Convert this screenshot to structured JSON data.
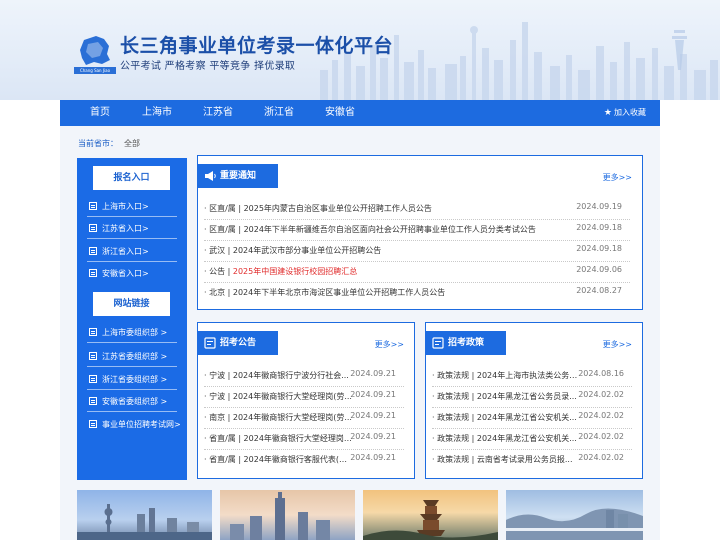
{
  "header": {
    "title": "长三角事业单位考录一体化平台",
    "slogan": "公平考试 严格考察 平等竞争 择优录取",
    "logo_caption": "Chang San Jiao"
  },
  "nav": {
    "items": [
      "首页",
      "上海市",
      "江苏省",
      "浙江省",
      "安徽省"
    ],
    "favorite": "加入收藏"
  },
  "crumb": {
    "label": "当前省市：",
    "value": "全部"
  },
  "sidebar": {
    "signup_title": "报名入口",
    "signup_links": [
      "上海市入口>",
      "江苏省入口>",
      "浙江省入口>",
      "安徽省入口>"
    ],
    "sites_title": "网站链接",
    "site_links": [
      "上海市委组织部 >",
      "江苏省委组织部 >",
      "浙江省委组织部 >",
      "安徽省委组织部 >",
      "事业单位招聘考试网>"
    ]
  },
  "notice": {
    "title": "重要通知",
    "more": "更多>>",
    "rows": [
      {
        "prefix": "· 区直/属 | ",
        "text": "2025年内蒙古自治区事业单位公开招聘工作人员公告",
        "date": "2024.09.19",
        "highlight": false
      },
      {
        "prefix": "· 区直/属 | ",
        "text": "2024年下半年新疆维吾尔自治区面向社会公开招聘事业单位工作人员分类考试公告",
        "date": "2024.09.18",
        "highlight": false
      },
      {
        "prefix": "· 武汉 | ",
        "text": "2024年武汉市部分事业单位公开招聘公告",
        "date": "2024.09.18",
        "highlight": false
      },
      {
        "prefix": "· 公告 | ",
        "text": "2025年中国建设银行校园招聘汇总",
        "date": "2024.09.06",
        "highlight": true
      },
      {
        "prefix": "· 北京 | ",
        "text": "2024年下半年北京市海淀区事业单位公开招聘工作人员公告",
        "date": "2024.08.27",
        "highlight": false
      }
    ]
  },
  "recruit": {
    "title": "招考公告",
    "more": "更多>>",
    "rows": [
      {
        "text": "· 宁波 | 2024年徽商银行宁波分行社会...",
        "date": "2024.09.21"
      },
      {
        "text": "· 宁波 | 2024年徽商银行大堂经理岗(劳...",
        "date": "2024.09.21"
      },
      {
        "text": "· 南京 | 2024年徽商银行大堂经理岗(劳...",
        "date": "2024.09.21"
      },
      {
        "text": "· 省直/属 | 2024年徽商银行大堂经理岗(...",
        "date": "2024.09.21"
      },
      {
        "text": "· 省直/属 | 2024年徽商银行客服代表(劳...",
        "date": "2024.09.21"
      }
    ]
  },
  "policy": {
    "title": "招考政策",
    "more": "更多>>",
    "rows": [
      {
        "text": "· 政策法规 | 2024年上海市执法类公务员...",
        "date": "2024.08.16"
      },
      {
        "text": "· 政策法规 | 2024年黑龙江省公务员录...",
        "date": "2024.02.02"
      },
      {
        "text": "· 政策法规 | 2024年黑龙江省公安机关...",
        "date": "2024.02.02"
      },
      {
        "text": "· 政策法规 | 2024年黑龙江省公安机关...",
        "date": "2024.02.02"
      },
      {
        "text": "· 政策法规 | 云南省考试录用公务员报...",
        "date": "2024.02.02"
      }
    ]
  },
  "colors": {
    "primary": "#1d6be0",
    "title": "#1b4fa8",
    "highlight": "#e02a2a"
  },
  "icons": {
    "notice": "megaphone-icon",
    "recruit": "document-icon",
    "policy": "document-icon",
    "favorite": "star-icon",
    "link": "list-icon"
  }
}
